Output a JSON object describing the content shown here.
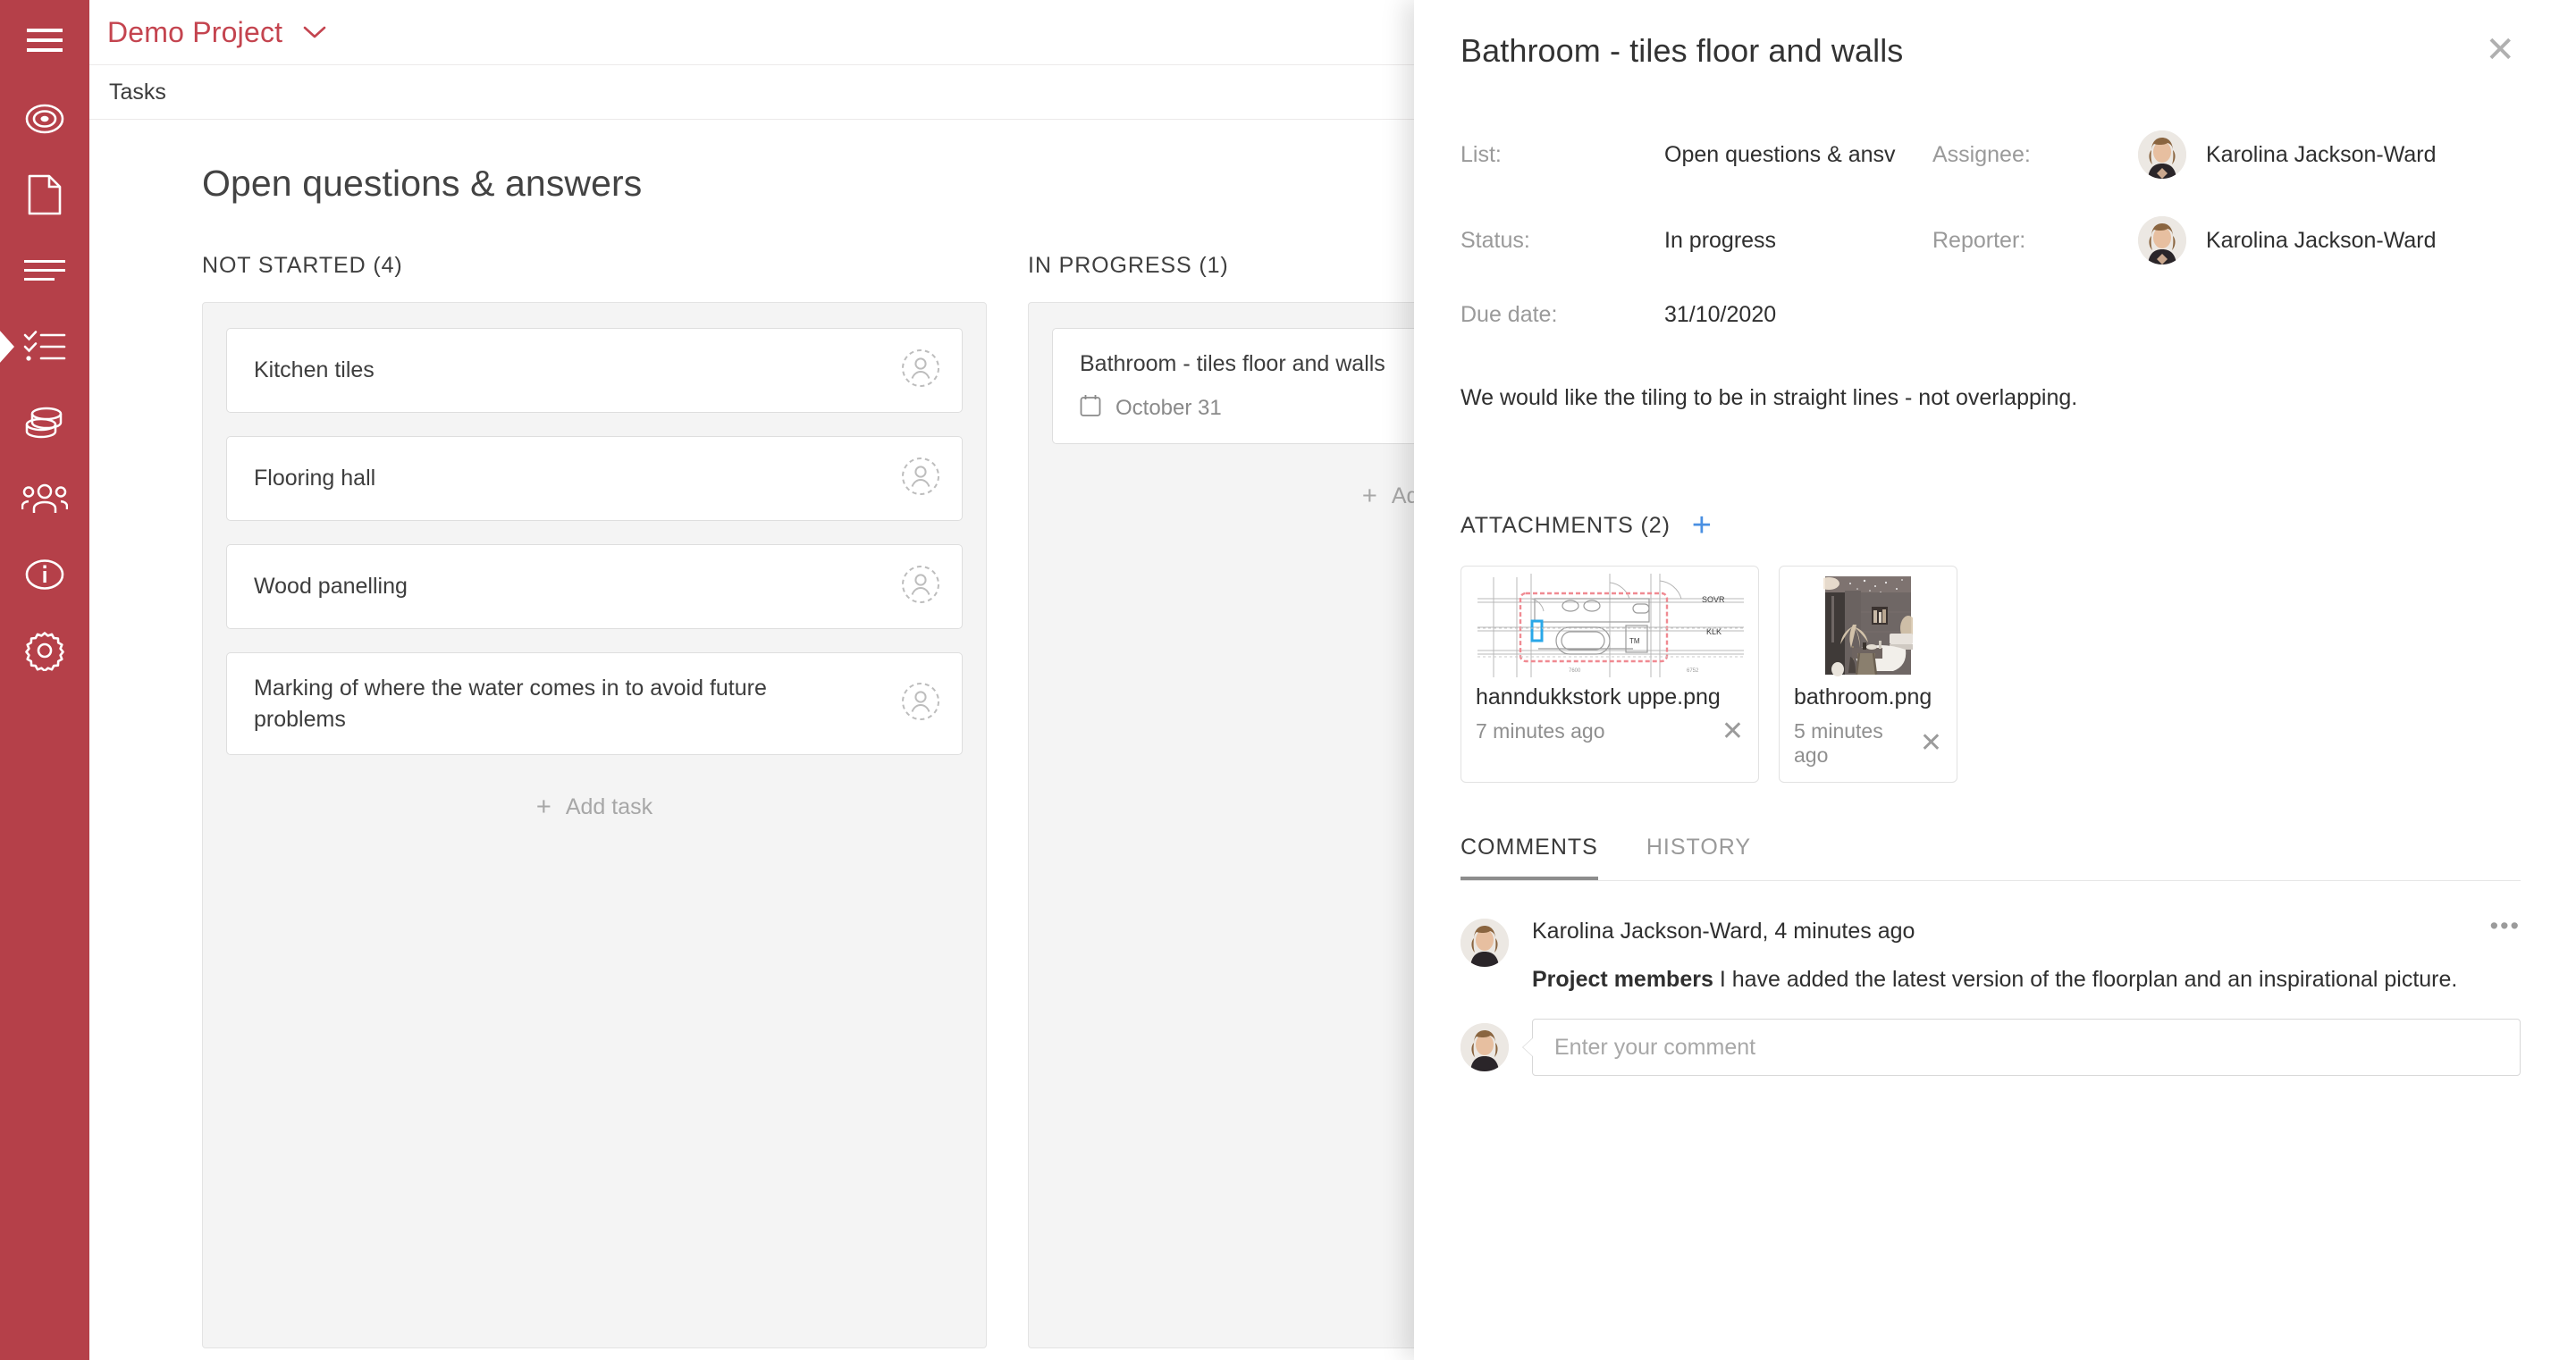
{
  "theme": {
    "brand_red": "#b54049",
    "accent_blue": "#4a90e2",
    "board_bg": "#f4f4f4"
  },
  "sidebar": {
    "items": [
      {
        "icon": "hamburger-menu-icon",
        "name": "menu"
      },
      {
        "icon": "target-icon",
        "name": "goals"
      },
      {
        "icon": "document-icon",
        "name": "documents"
      },
      {
        "icon": "list-lines-icon",
        "name": "lists"
      },
      {
        "icon": "checklist-icon",
        "name": "tasks",
        "active": true
      },
      {
        "icon": "database-stack-icon",
        "name": "resources"
      },
      {
        "icon": "people-group-icon",
        "name": "team"
      },
      {
        "icon": "info-circle-icon",
        "name": "info"
      },
      {
        "icon": "gear-icon",
        "name": "settings"
      }
    ]
  },
  "header": {
    "project_name": "Demo Project",
    "dropdown_icon": "chevron-down-icon"
  },
  "tabs_bar": {
    "tabs": [
      {
        "label": "Tasks",
        "active": true
      }
    ]
  },
  "board": {
    "title": "Open questions & answers",
    "add_task_label": "Add task",
    "columns": [
      {
        "header": "NOT STARTED (4)",
        "cards": [
          {
            "title": "Kitchen tiles",
            "assignee_icon": "person-placeholder-icon"
          },
          {
            "title": "Flooring hall",
            "assignee_icon": "person-placeholder-icon"
          },
          {
            "title": "Wood panelling",
            "assignee_icon": "person-placeholder-icon"
          },
          {
            "title": "Marking of where the water comes in to avoid future problems",
            "assignee_icon": "person-placeholder-icon"
          }
        ]
      },
      {
        "header": "IN PROGRESS (1)",
        "cards": [
          {
            "title": "Bathroom - tiles floor and walls",
            "due": "October 31",
            "due_icon": "calendar-icon"
          }
        ]
      }
    ]
  },
  "panel": {
    "title": "Bathroom - tiles floor and walls",
    "close_icon": "close-icon",
    "fields": {
      "list_label": "List:",
      "list_value": "Open questions & ansv",
      "assignee_label": "Assignee:",
      "assignee_value": "Karolina Jackson-Ward",
      "status_label": "Status:",
      "status_value": "In progress",
      "reporter_label": "Reporter:",
      "reporter_value": "Karolina Jackson-Ward",
      "due_label": "Due date:",
      "due_value": "31/10/2020"
    },
    "description": "We would like the tiling to be in straight lines - not overlapping.",
    "attachments": {
      "header": "ATTACHMENTS (2)",
      "add_icon": "plus-icon",
      "items": [
        {
          "name": "hanndukkstork uppe.png",
          "time": "7 minutes ago",
          "thumb": "floorplan-thumbnail",
          "remove_icon": "close-icon",
          "plan_labels": [
            "SOVR",
            "KLK",
            "TM",
            "7600",
            "6752"
          ]
        },
        {
          "name": "bathroom.png",
          "time": "5 minutes ago",
          "thumb": "bathroom-photo-thumbnail",
          "remove_icon": "close-icon"
        }
      ]
    },
    "tabs": [
      {
        "label": "COMMENTS",
        "active": true
      },
      {
        "label": "HISTORY",
        "active": false
      }
    ],
    "comments": [
      {
        "meta": "Karolina Jackson-Ward, 4 minutes ago",
        "mention": "Project members",
        "text": " I have added the latest version of the floorplan and an inspirational picture.",
        "menu_icon": "more-options-icon"
      }
    ],
    "comment_box": {
      "placeholder": "Enter your comment",
      "value": ""
    }
  }
}
